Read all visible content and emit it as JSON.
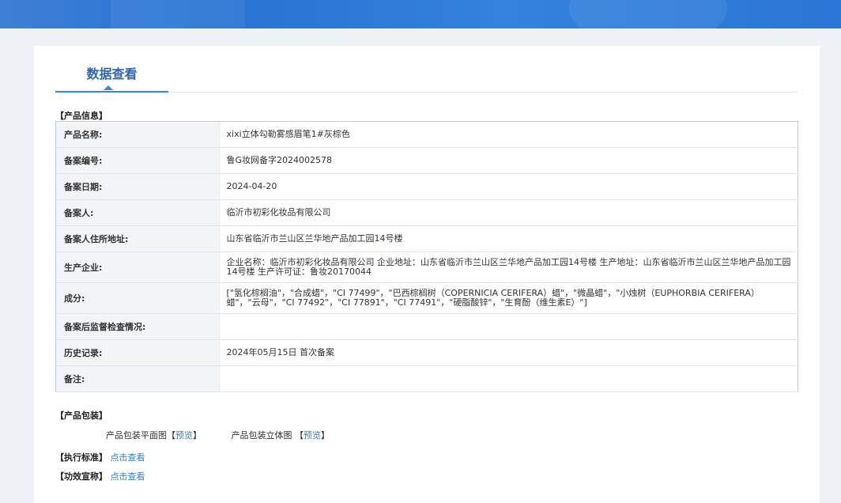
{
  "tab": {
    "title": "数据查看"
  },
  "product_info": {
    "heading": "【产品信息】",
    "rows": [
      {
        "key": "产品名称:",
        "value": "xixi立体勾勒雾感眉笔1#灰棕色"
      },
      {
        "key": "备案编号:",
        "value": "鲁G妆网备字2024002578"
      },
      {
        "key": "备案日期:",
        "value": "2024-04-20"
      },
      {
        "key": "备案人:",
        "value": "临沂市初彩化妆品有限公司"
      },
      {
        "key": "备案人住所地址:",
        "value": "山东省临沂市兰山区兰华地产品加工园14号楼"
      },
      {
        "key": "生产企业:",
        "value": "企业名称：临沂市初彩化妆品有限公司 企业地址：山东省临沂市兰山区兰华地产品加工园14号楼 生产地址：山东省临沂市兰山区兰华地产品加工园14号楼 生产许可证：鲁妆20170044"
      },
      {
        "key": "成分:",
        "value": "[\"氢化棕榈油\"，\"合成蜡\"，\"CI 77499\"，\"巴西棕榈树（COPERNICIA CERIFERA）蜡\"，\"微晶蜡\"，\"小烛树（EUPHORBIA CERIFERA）蜡\"，\"云母\"，\"CI 77492\"，\"CI 77891\"，\"CI 77491\"，\"硬脂酸锌\"，\"生育酚（维生素E）\"]"
      },
      {
        "key": "备案后监督检查情况:",
        "value": ""
      },
      {
        "key": "历史记录:",
        "value": "2024年05月15日 首次备案"
      },
      {
        "key": "备注:",
        "value": ""
      }
    ]
  },
  "packaging": {
    "heading": "【产品包装】",
    "flat_label": "产品包装平面图",
    "solid_label": "产品包装立体图",
    "bracket_open": "【",
    "bracket_close": "】",
    "preview_link": "预览"
  },
  "standard": {
    "heading": "【执行标准】",
    "link": "点击查看"
  },
  "efficacy": {
    "heading": "【功效宣称】",
    "link": "点击查看"
  }
}
